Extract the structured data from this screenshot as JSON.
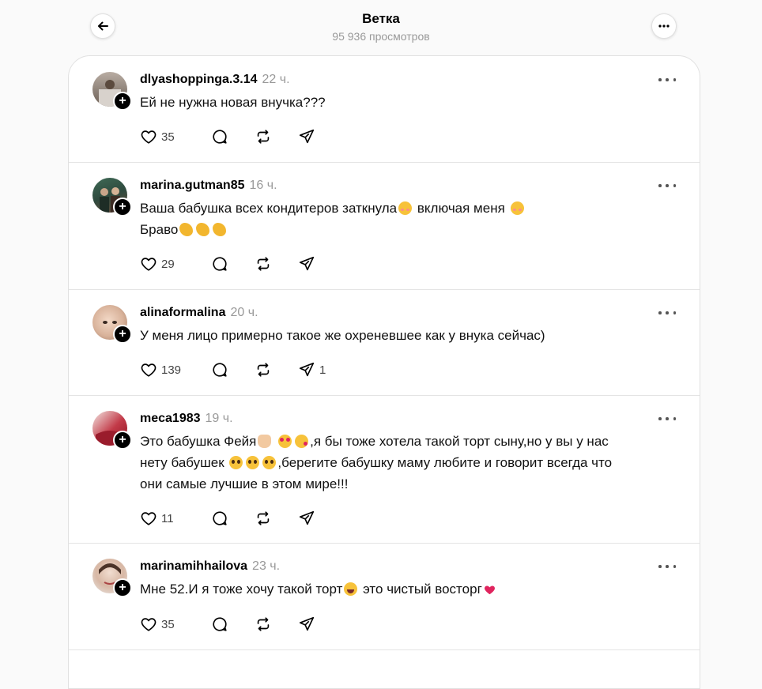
{
  "header": {
    "title": "Ветка",
    "views": "95 936 просмотров",
    "back_icon": "arrow-left-icon",
    "more_icon": "more-horizontal-icon"
  },
  "colors": {
    "background": "#fafafa",
    "card": "#ffffff",
    "muted_text": "#999999",
    "divider": "#e4e4e4"
  },
  "posts": [
    {
      "username": "dlyashoppinga.3.14",
      "time": "22 ч.",
      "lines": [
        "Ей не нужна новая внучка???"
      ],
      "likes": "35",
      "replies": "",
      "reposts": "",
      "shares": ""
    },
    {
      "username": "marina.gutman85",
      "time": "16 ч.",
      "line1a": "Ваша бабушка всех кондитеров заткнула",
      "line1b": " включая меня ",
      "line2": "Браво",
      "likes": "29",
      "replies": "",
      "reposts": "",
      "shares": ""
    },
    {
      "username": "alinaformalina",
      "time": "20 ч.",
      "lines": [
        "У меня лицо примерно такое же охреневшее как у внука сейчас)"
      ],
      "likes": "139",
      "replies": "",
      "reposts": "",
      "shares": "1"
    },
    {
      "username": "meca1983",
      "time": "19 ч.",
      "line1a": "Это бабушка Фейя",
      "line1b": ",я бы тоже хотела такой торт сыну,но у вы у нас",
      "line2a": "нету бабушек",
      "line2b": ",берегите бабушку маму любите и говорит всегда что",
      "line3": "они самые лучшие в этом мире!!!",
      "likes": "11",
      "replies": "",
      "reposts": "",
      "shares": ""
    },
    {
      "username": "marinamihhailova",
      "time": "23 ч.",
      "line1a": "Мне 52.И я тоже хочу такой торт",
      "line1b": " это чистый восторг",
      "likes": "35",
      "replies": "",
      "reposts": "",
      "shares": ""
    }
  ]
}
